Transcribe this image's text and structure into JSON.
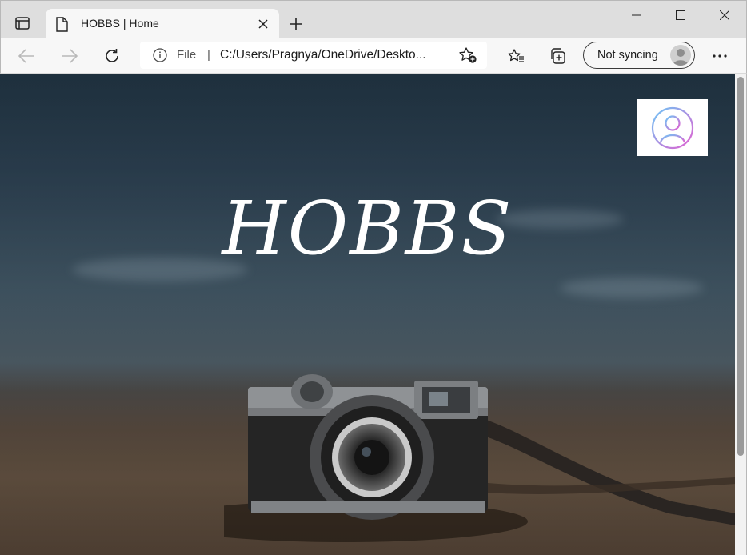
{
  "browser": {
    "tab_title": "HOBBS | Home",
    "address": {
      "scheme_label": "File",
      "separator": "|",
      "url": "C:/Users/Pragnya/OneDrive/Deskto..."
    },
    "sync_label": "Not syncing",
    "icons": [
      "tab-actions-icon",
      "page-icon",
      "close-icon",
      "plus-icon",
      "minimize-icon",
      "maximize-icon",
      "window-close-icon",
      "back-arrow-icon",
      "forward-arrow-icon",
      "reload-icon",
      "info-icon",
      "add-favorite-icon",
      "favorites-icon",
      "collections-icon",
      "profile-avatar-icon",
      "more-icon"
    ]
  },
  "page": {
    "hero_title": "HOBBS",
    "profile_icon": "user-circle-icon",
    "colors": {
      "profile_gradient_start": "#6ec6f5",
      "profile_gradient_end": "#e25fd1"
    }
  }
}
